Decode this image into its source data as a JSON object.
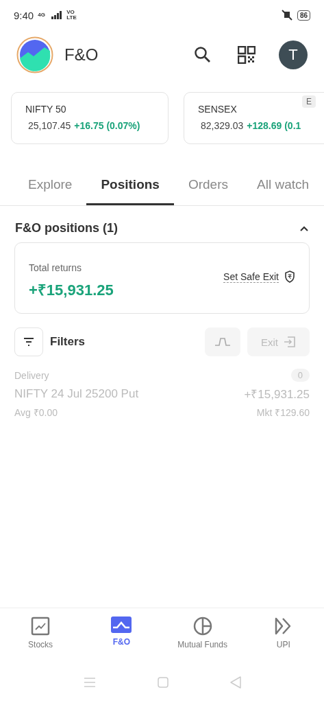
{
  "status_bar": {
    "time": "9:40",
    "network": "4G",
    "volte": "VO LTE",
    "battery": "86"
  },
  "header": {
    "title": "F&O",
    "avatar": "T"
  },
  "indices": [
    {
      "name": "NIFTY 50",
      "value": "25,107.45",
      "change": "+16.75 (0.07%)"
    },
    {
      "name": "SENSEX",
      "value": "82,329.03",
      "change": "+128.69 (0.1",
      "badge": "E"
    }
  ],
  "tabs": [
    {
      "label": "Explore",
      "selected": false
    },
    {
      "label": "Positions",
      "selected": true
    },
    {
      "label": "Orders",
      "selected": false
    },
    {
      "label": "All watch",
      "selected": false
    }
  ],
  "section": {
    "title": "F&O positions (1)",
    "expanded": true
  },
  "summary": {
    "label": "Total returns",
    "value": "+₹15,931.25",
    "action": "Set Safe Exit"
  },
  "toolbar": {
    "filters": "Filters",
    "exit": "Exit",
    "exit_disabled": true,
    "chart_disabled": true
  },
  "positions": [
    {
      "product": "Delivery",
      "qty": "0",
      "name": "NIFTY 24 Jul 25200 Put",
      "pnl": "+₹15,931.25",
      "avg": "Avg ₹0.00",
      "ltp": "Mkt ₹129.60",
      "disabled": true
    }
  ],
  "bottom_nav": [
    {
      "label": "Stocks",
      "kind": "stocks",
      "selected": false
    },
    {
      "label": "F&O",
      "kind": "fno",
      "selected": true
    },
    {
      "label": "Mutual Funds",
      "kind": "funds",
      "selected": false
    },
    {
      "label": "UPI",
      "kind": "upi",
      "selected": false
    }
  ]
}
